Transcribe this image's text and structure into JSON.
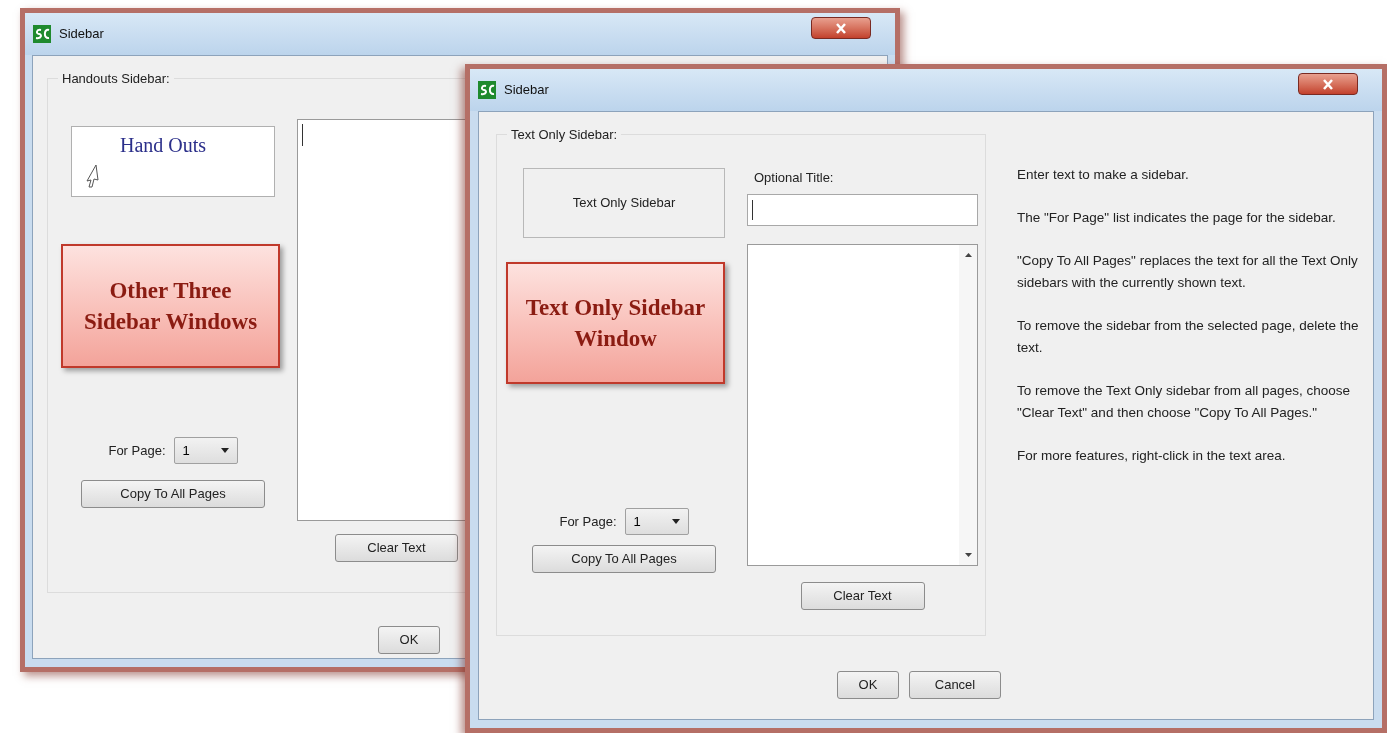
{
  "windows": [
    {
      "kind": "handouts",
      "title": "Sidebar",
      "group_label": "Handouts Sidebar:",
      "preview_text": "Hand Outs",
      "for_page_label": "For Page:",
      "for_page_value": "1",
      "copy_button": "Copy To All Pages",
      "clear_button": "Clear Text",
      "buttons": [
        "OK"
      ],
      "callout": "Other Three Sidebar Windows"
    },
    {
      "kind": "text_only",
      "title": "Sidebar",
      "group_label": "Text Only Sidebar:",
      "preview_text": "Text Only Sidebar",
      "title_label": "Optional Title:",
      "for_page_label": "For Page:",
      "for_page_value": "1",
      "copy_button": "Copy To All Pages",
      "clear_button": "Clear Text",
      "buttons": [
        "OK",
        "Cancel"
      ],
      "callout": "Text Only Sidebar Window",
      "help": [
        "Enter text to make a sidebar.",
        "The \"For Page\" list indicates the page for the sidebar.",
        "\"Copy To All Pages\" replaces the text for all the Text Only sidebars with the currently shown text.",
        "To remove the sidebar from the selected page, delete the text.",
        "To remove the Text Only sidebar from all pages, choose \"Clear Text\" and then choose \"Copy To All Pages.\"",
        "For more features, right-click in the text area."
      ]
    }
  ]
}
